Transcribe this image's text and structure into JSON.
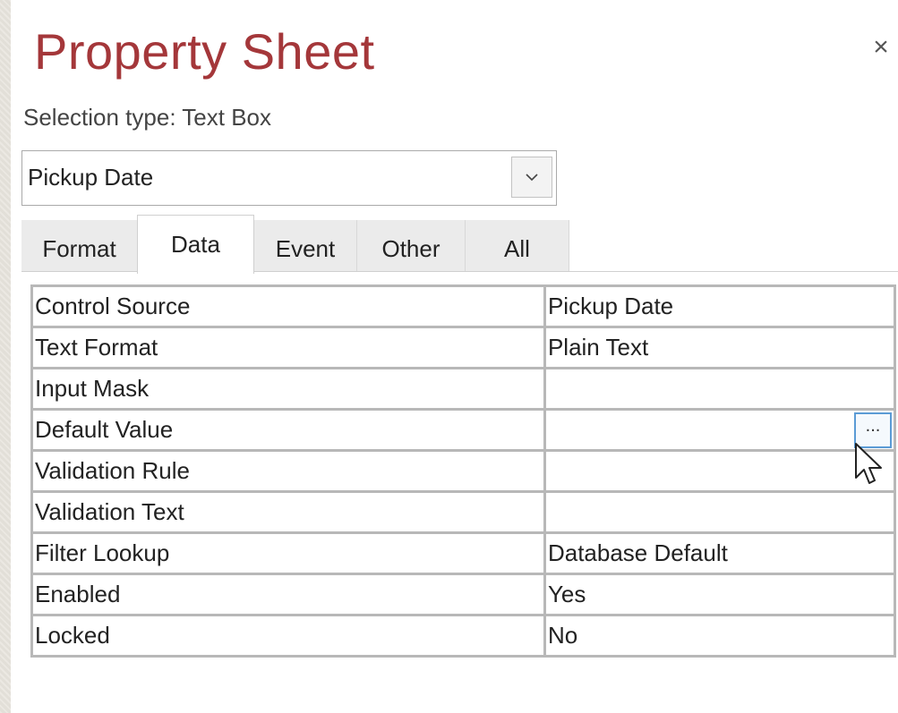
{
  "header": {
    "title": "Property Sheet",
    "close_glyph": "×",
    "selection_type": "Selection type: Text Box"
  },
  "selector": {
    "value": "Pickup Date"
  },
  "tabs": [
    {
      "label": "Format",
      "active": false
    },
    {
      "label": "Data",
      "active": true
    },
    {
      "label": "Event",
      "active": false
    },
    {
      "label": "Other",
      "active": false
    },
    {
      "label": "All",
      "active": false
    }
  ],
  "properties": [
    {
      "name": "Control Source",
      "value": "Pickup Date"
    },
    {
      "name": "Text Format",
      "value": "Plain Text"
    },
    {
      "name": "Input Mask",
      "value": ""
    },
    {
      "name": "Default Value",
      "value": ""
    },
    {
      "name": "Validation Rule",
      "value": ""
    },
    {
      "name": "Validation Text",
      "value": ""
    },
    {
      "name": "Filter Lookup",
      "value": "Database Default"
    },
    {
      "name": "Enabled",
      "value": "Yes"
    },
    {
      "name": "Locked",
      "value": "No"
    }
  ],
  "builder_button_label": "...",
  "colors": {
    "title": "#a4373a",
    "builder_focus": "#5b9bd5"
  }
}
